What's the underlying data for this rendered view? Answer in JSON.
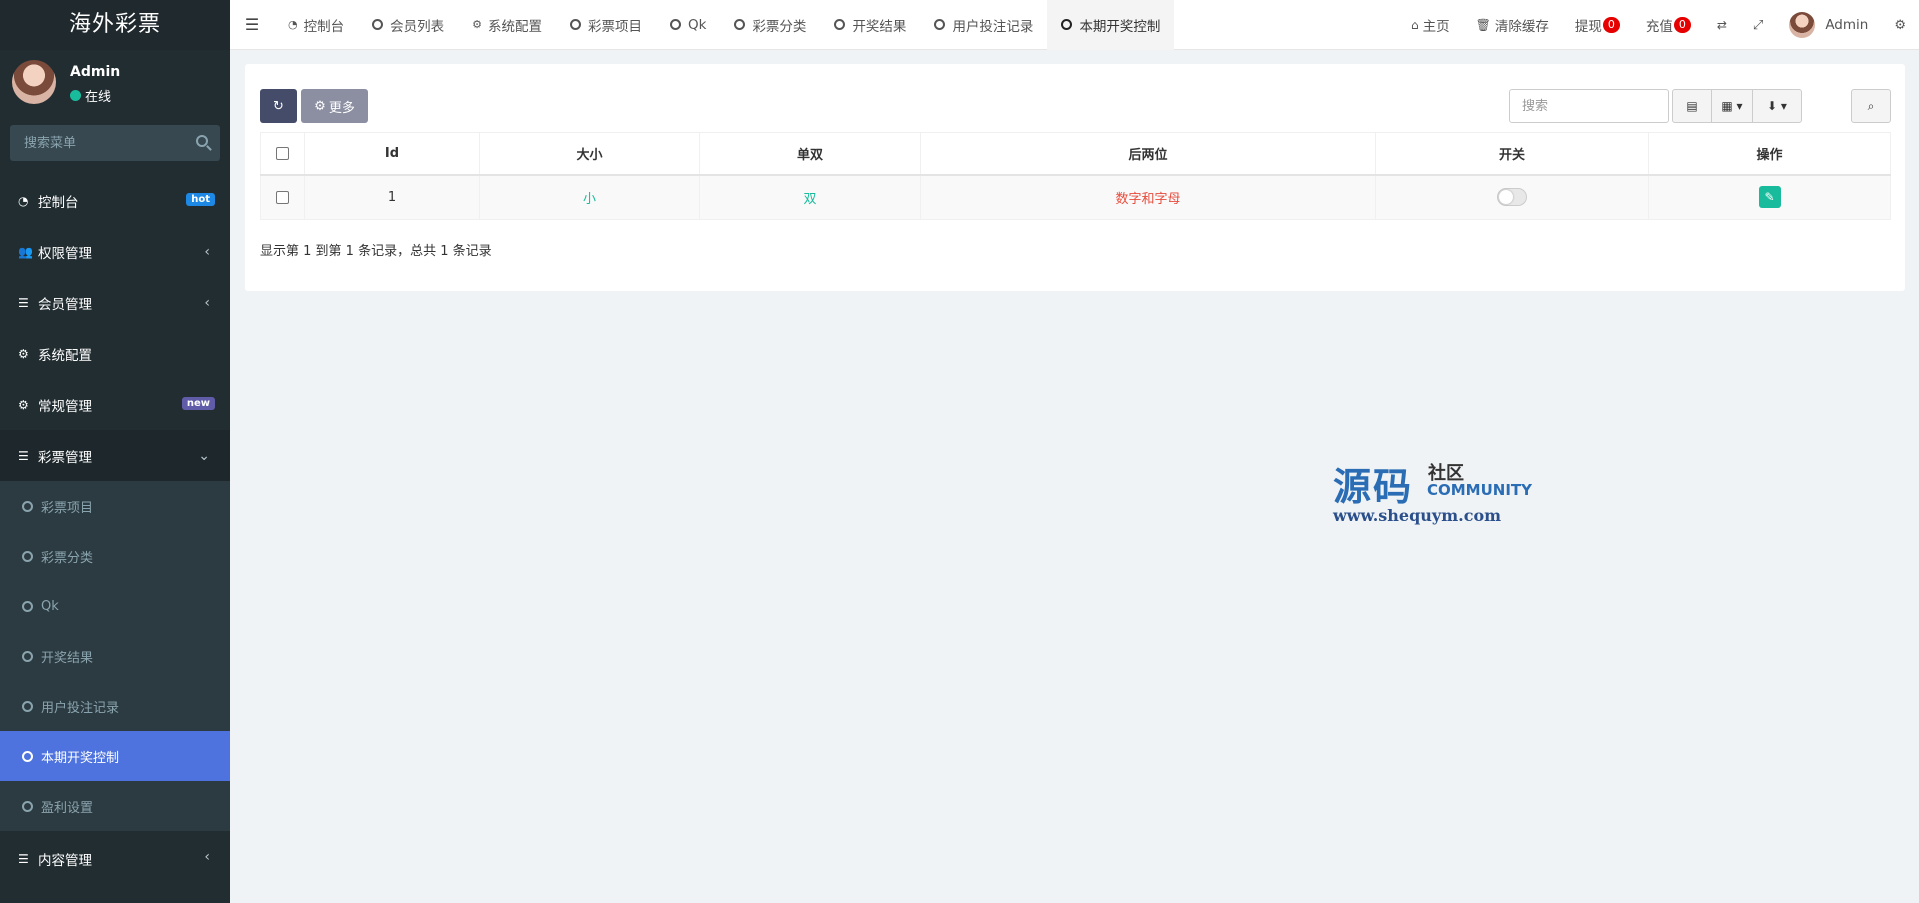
{
  "app": {
    "title": "海外彩票"
  },
  "user": {
    "name": "Admin",
    "status": "在线"
  },
  "sidebar": {
    "search_placeholder": "搜索菜单",
    "items": [
      {
        "label": "控制台",
        "badge": "hot"
      },
      {
        "label": "权限管理"
      },
      {
        "label": "会员管理"
      },
      {
        "label": "系统配置"
      },
      {
        "label": "常规管理",
        "badge": "new"
      },
      {
        "label": "彩票管理"
      }
    ],
    "sub_items": [
      "彩票项目",
      "彩票分类",
      "Qk",
      "开奖结果",
      "用户投注记录",
      "本期开奖控制",
      "盈利设置"
    ],
    "bottom_item": {
      "label": "内容管理"
    }
  },
  "tabs": [
    "控制台",
    "会员列表",
    "系统配置",
    "彩票项目",
    "Qk",
    "彩票分类",
    "开奖结果",
    "用户投注记录",
    "本期开奖控制"
  ],
  "top_right": {
    "home": "主页",
    "clear_cache": "清除缓存",
    "withdraw": "提现",
    "withdraw_count": "0",
    "recharge": "充值",
    "recharge_count": "0",
    "user": "Admin"
  },
  "toolbar": {
    "more_label": "更多",
    "search_placeholder": "搜索"
  },
  "table": {
    "columns": [
      "Id",
      "大小",
      "单双",
      "后两位",
      "开关",
      "操作"
    ],
    "rows": [
      {
        "id": "1",
        "size": "小",
        "parity": "双",
        "last_two": "数字和字母",
        "switch_on": false
      }
    ]
  },
  "pager_info": "显示第 1 到第 1 条记录，总共 1 条记录",
  "watermark": {
    "main": "源码",
    "side": "社区",
    "sub": "COMMUNITY",
    "url": "www.shequym.com"
  },
  "colors": {
    "sidebar_bg": "#222d32",
    "active_menu": "#4e73df",
    "accent_green": "#18bc9c",
    "accent_red": "#e74c3c",
    "badge_count": "#e60000"
  }
}
